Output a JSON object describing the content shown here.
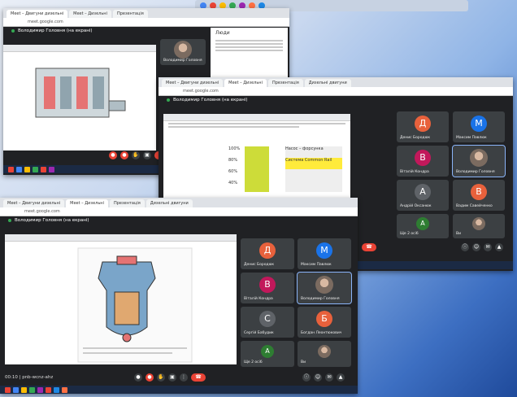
{
  "meeting_title": "Володимир Головня (на екрані)",
  "url": "meet.google.com",
  "tabs": [
    "Meet – Двигуни дизельні",
    "Meet – Дизельні",
    "Презентація",
    "Дизельні двигуни"
  ],
  "people_panel_title": "Люди",
  "participants": [
    {
      "name": "Денис Бородюк",
      "initial": "Д",
      "color": "#e8613c"
    },
    {
      "name": "Максим Павлюк",
      "initial": "M",
      "color": "#1a73e8"
    },
    {
      "name": "Віталій Кондра",
      "initial": "B",
      "color": "#c2185b"
    },
    {
      "name": "Володимир Головня",
      "initial": "",
      "color": "#5f6368"
    },
    {
      "name": "Андрій Оксанюк",
      "initial": "A",
      "color": "#5f6368"
    },
    {
      "name": "Вадим Савейченко",
      "initial": "B",
      "color": "#e8613c"
    },
    {
      "name": "Сергій Бабудик",
      "initial": "C",
      "color": "#5f6368"
    },
    {
      "name": "Богдан Леонтюкович",
      "initial": "Б",
      "color": "#e8613c"
    },
    {
      "name": "Ще 2 осіб",
      "initial": "A",
      "color": "#2e7d32"
    },
    {
      "name": "Ви",
      "initial": "",
      "color": "#5f6368"
    }
  ],
  "bottom_left": "00:10 | pnb-wcnz-ahz",
  "table_rows": [
    "100%",
    "80%",
    "60%",
    "40%"
  ],
  "table_right_labels": [
    "Насос – форсунка",
    "Система Common Rail"
  ]
}
